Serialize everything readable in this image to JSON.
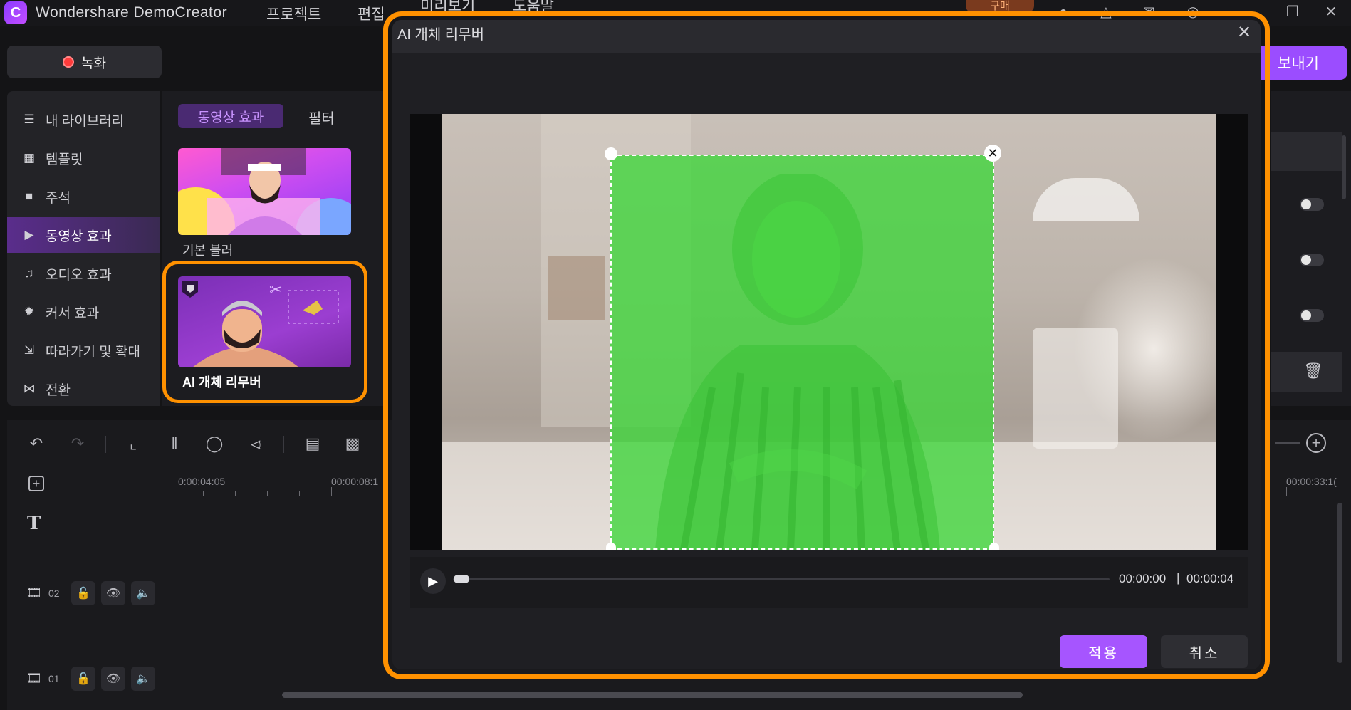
{
  "app": {
    "title": "Wondershare DemoCreator",
    "logo_letter": "C"
  },
  "menu": [
    "프로젝트",
    "편집",
    "미리보기",
    "도움말"
  ],
  "header": {
    "buy_label": "구매",
    "record_label": "녹화",
    "export_label": "보내기"
  },
  "sidebar": {
    "items": [
      {
        "label": "내 라이브러리",
        "icon": "layers-icon"
      },
      {
        "label": "템플릿",
        "icon": "template-icon"
      },
      {
        "label": "주석",
        "icon": "annotation-icon"
      },
      {
        "label": "동영상 효과",
        "icon": "video-effects-icon",
        "active": true
      },
      {
        "label": "오디오 효과",
        "icon": "music-note-icon"
      },
      {
        "label": "커서 효과",
        "icon": "cursor-sparkle-icon"
      },
      {
        "label": "따라가기 및 확대",
        "icon": "zoom-follow-icon"
      },
      {
        "label": "전환",
        "icon": "transition-icon"
      }
    ]
  },
  "effects": {
    "tabs": [
      {
        "label": "동영상 효과",
        "active": true
      },
      {
        "label": "필터"
      }
    ],
    "items": [
      {
        "label": "기본 블러"
      },
      {
        "label": "AI 개체 리무버"
      }
    ]
  },
  "timeline": {
    "times": [
      "0:00:04:05",
      "00:00:08:1",
      "00:00:33:1("
    ],
    "tracks": [
      {
        "num": "02"
      },
      {
        "num": "01"
      }
    ]
  },
  "modal": {
    "title": "AI 개체 리무버",
    "time_current": "00:00:00",
    "time_separator": "|",
    "time_total": "00:00:04",
    "progress": 0,
    "apply_label": "적용",
    "cancel_label": "취소",
    "selection_color": "#3ed63a"
  },
  "colors": {
    "accent": "#9b4dff",
    "highlight": "#ff9100"
  }
}
